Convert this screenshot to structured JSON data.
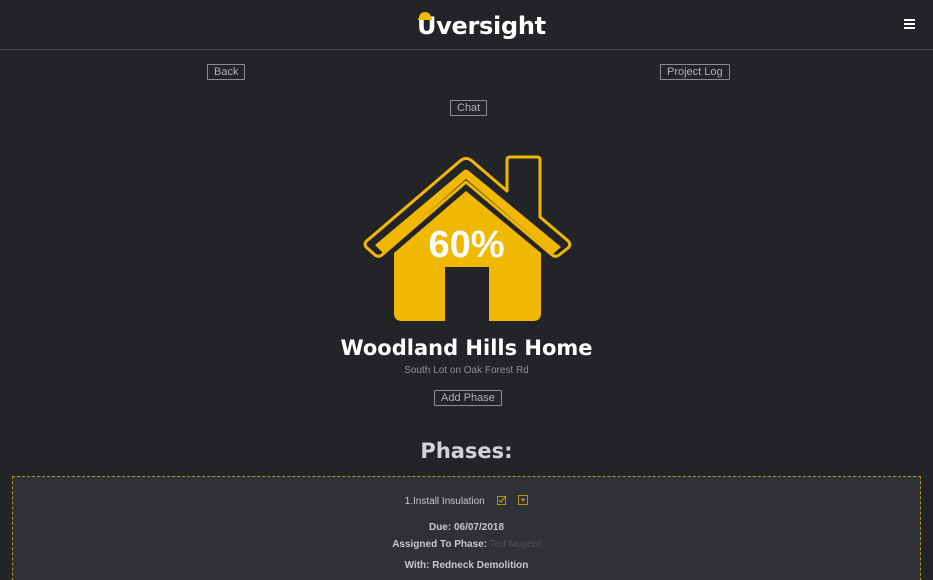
{
  "header": {
    "logo_text_rest": "versight",
    "logo_letter": "U",
    "menu_icon": "hamburger-icon"
  },
  "nav": {
    "back_label": "Back",
    "project_log_label": "Project Log",
    "chat_label": "Chat"
  },
  "project": {
    "progress_percent": 60,
    "progress_label": "60%",
    "title": "Woodland Hills Home",
    "location": "South Lot on Oak Forest Rd",
    "add_phase_label": "Add Phase"
  },
  "phases": {
    "heading": "Phases:",
    "items": [
      {
        "name": "1.Install Insulation",
        "due_label": "Due: 06/07/2018",
        "assigned_label": "Assigned To Phase:",
        "assigned_value": "Ted Nugent",
        "with_label": "With: Redneck Demolition",
        "icons": [
          "checkbox-icon",
          "dropdown-toggle-icon"
        ]
      }
    ]
  },
  "colors": {
    "background": "#222428",
    "accent_yellow": "#f0b800",
    "card_background": "#2f3135",
    "card_border": "#b0921a"
  }
}
